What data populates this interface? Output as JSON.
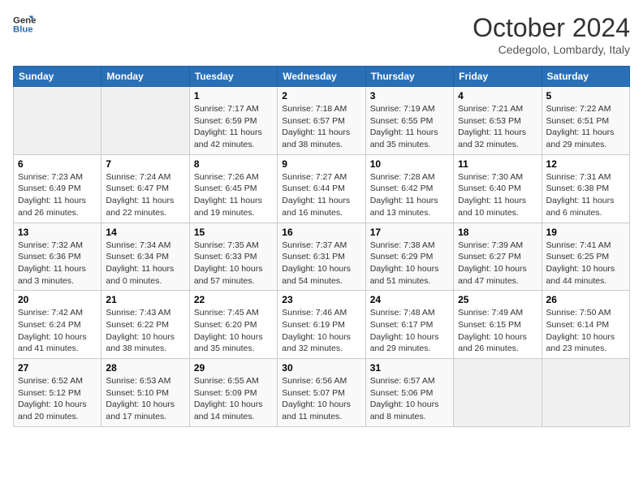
{
  "logo": {
    "line1": "General",
    "line2": "Blue"
  },
  "title": "October 2024",
  "subtitle": "Cedegolo, Lombardy, Italy",
  "weekdays": [
    "Sunday",
    "Monday",
    "Tuesday",
    "Wednesday",
    "Thursday",
    "Friday",
    "Saturday"
  ],
  "weeks": [
    [
      {
        "day": "",
        "info": ""
      },
      {
        "day": "",
        "info": ""
      },
      {
        "day": "1",
        "info": "Sunrise: 7:17 AM\nSunset: 6:59 PM\nDaylight: 11 hours and 42 minutes."
      },
      {
        "day": "2",
        "info": "Sunrise: 7:18 AM\nSunset: 6:57 PM\nDaylight: 11 hours and 38 minutes."
      },
      {
        "day": "3",
        "info": "Sunrise: 7:19 AM\nSunset: 6:55 PM\nDaylight: 11 hours and 35 minutes."
      },
      {
        "day": "4",
        "info": "Sunrise: 7:21 AM\nSunset: 6:53 PM\nDaylight: 11 hours and 32 minutes."
      },
      {
        "day": "5",
        "info": "Sunrise: 7:22 AM\nSunset: 6:51 PM\nDaylight: 11 hours and 29 minutes."
      }
    ],
    [
      {
        "day": "6",
        "info": "Sunrise: 7:23 AM\nSunset: 6:49 PM\nDaylight: 11 hours and 26 minutes."
      },
      {
        "day": "7",
        "info": "Sunrise: 7:24 AM\nSunset: 6:47 PM\nDaylight: 11 hours and 22 minutes."
      },
      {
        "day": "8",
        "info": "Sunrise: 7:26 AM\nSunset: 6:45 PM\nDaylight: 11 hours and 19 minutes."
      },
      {
        "day": "9",
        "info": "Sunrise: 7:27 AM\nSunset: 6:44 PM\nDaylight: 11 hours and 16 minutes."
      },
      {
        "day": "10",
        "info": "Sunrise: 7:28 AM\nSunset: 6:42 PM\nDaylight: 11 hours and 13 minutes."
      },
      {
        "day": "11",
        "info": "Sunrise: 7:30 AM\nSunset: 6:40 PM\nDaylight: 11 hours and 10 minutes."
      },
      {
        "day": "12",
        "info": "Sunrise: 7:31 AM\nSunset: 6:38 PM\nDaylight: 11 hours and 6 minutes."
      }
    ],
    [
      {
        "day": "13",
        "info": "Sunrise: 7:32 AM\nSunset: 6:36 PM\nDaylight: 11 hours and 3 minutes."
      },
      {
        "day": "14",
        "info": "Sunrise: 7:34 AM\nSunset: 6:34 PM\nDaylight: 11 hours and 0 minutes."
      },
      {
        "day": "15",
        "info": "Sunrise: 7:35 AM\nSunset: 6:33 PM\nDaylight: 10 hours and 57 minutes."
      },
      {
        "day": "16",
        "info": "Sunrise: 7:37 AM\nSunset: 6:31 PM\nDaylight: 10 hours and 54 minutes."
      },
      {
        "day": "17",
        "info": "Sunrise: 7:38 AM\nSunset: 6:29 PM\nDaylight: 10 hours and 51 minutes."
      },
      {
        "day": "18",
        "info": "Sunrise: 7:39 AM\nSunset: 6:27 PM\nDaylight: 10 hours and 47 minutes."
      },
      {
        "day": "19",
        "info": "Sunrise: 7:41 AM\nSunset: 6:25 PM\nDaylight: 10 hours and 44 minutes."
      }
    ],
    [
      {
        "day": "20",
        "info": "Sunrise: 7:42 AM\nSunset: 6:24 PM\nDaylight: 10 hours and 41 minutes."
      },
      {
        "day": "21",
        "info": "Sunrise: 7:43 AM\nSunset: 6:22 PM\nDaylight: 10 hours and 38 minutes."
      },
      {
        "day": "22",
        "info": "Sunrise: 7:45 AM\nSunset: 6:20 PM\nDaylight: 10 hours and 35 minutes."
      },
      {
        "day": "23",
        "info": "Sunrise: 7:46 AM\nSunset: 6:19 PM\nDaylight: 10 hours and 32 minutes."
      },
      {
        "day": "24",
        "info": "Sunrise: 7:48 AM\nSunset: 6:17 PM\nDaylight: 10 hours and 29 minutes."
      },
      {
        "day": "25",
        "info": "Sunrise: 7:49 AM\nSunset: 6:15 PM\nDaylight: 10 hours and 26 minutes."
      },
      {
        "day": "26",
        "info": "Sunrise: 7:50 AM\nSunset: 6:14 PM\nDaylight: 10 hours and 23 minutes."
      }
    ],
    [
      {
        "day": "27",
        "info": "Sunrise: 6:52 AM\nSunset: 5:12 PM\nDaylight: 10 hours and 20 minutes."
      },
      {
        "day": "28",
        "info": "Sunrise: 6:53 AM\nSunset: 5:10 PM\nDaylight: 10 hours and 17 minutes."
      },
      {
        "day": "29",
        "info": "Sunrise: 6:55 AM\nSunset: 5:09 PM\nDaylight: 10 hours and 14 minutes."
      },
      {
        "day": "30",
        "info": "Sunrise: 6:56 AM\nSunset: 5:07 PM\nDaylight: 10 hours and 11 minutes."
      },
      {
        "day": "31",
        "info": "Sunrise: 6:57 AM\nSunset: 5:06 PM\nDaylight: 10 hours and 8 minutes."
      },
      {
        "day": "",
        "info": ""
      },
      {
        "day": "",
        "info": ""
      }
    ]
  ]
}
